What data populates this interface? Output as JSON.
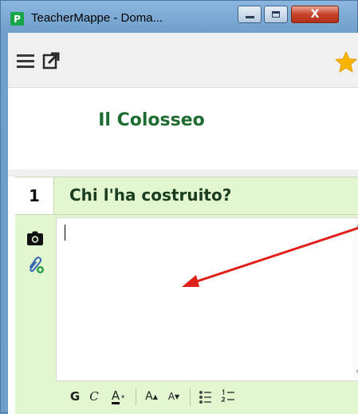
{
  "window": {
    "title": "TeacherMappe - Doma...",
    "app_icon_letter": "P",
    "close_label": "X"
  },
  "toolbar": {
    "menu_icon": "hamburger-menu-icon",
    "open_icon": "open-external-icon",
    "star_icon": "star-icon",
    "star_color": "#f7b500"
  },
  "document": {
    "title": "Il Colosseo",
    "title_color": "#1f6c32"
  },
  "question": {
    "number": "1",
    "text": "Chi l'ha costruito?",
    "background": "#e2f6cf"
  },
  "answer": {
    "value": "",
    "side_icons": [
      "camera-icon",
      "attachment-add-icon"
    ],
    "annotation_arrow_color": "#e0201a"
  },
  "format_bar": {
    "bold": "G",
    "italic": "C",
    "font_color": "A",
    "font_color_dropdown": "▾",
    "grow": "A",
    "grow_mark": "▲",
    "shrink": "A",
    "shrink_mark": "▼",
    "bullets_icon": "bulleted-list-icon",
    "numbers_icon": "numbered-list-icon"
  }
}
